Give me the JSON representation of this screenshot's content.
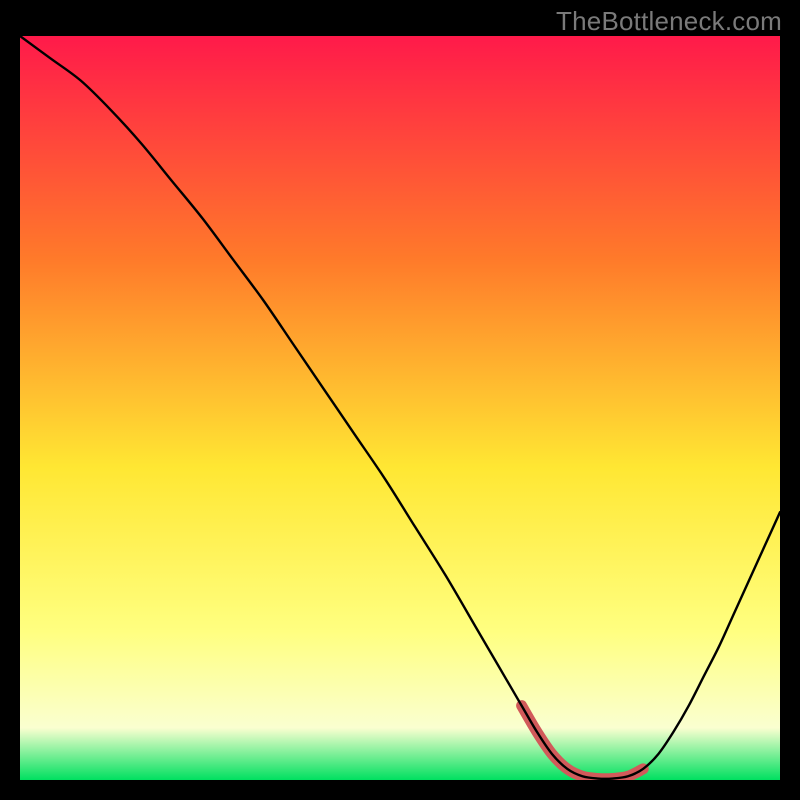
{
  "watermark": "TheBottleneck.com",
  "colors": {
    "outer_bg": "#000000",
    "line": "#000000",
    "highlight": "#d15a5a",
    "grad_top": "#ff1a4a",
    "grad_upper": "#ff7a2a",
    "grad_mid": "#ffe733",
    "grad_lowmid": "#ffff80",
    "grad_low": "#faffd0",
    "grad_bottom": "#00e060"
  },
  "chart_data": {
    "type": "line",
    "title": "",
    "xlabel": "",
    "ylabel": "",
    "xlim": [
      0,
      100
    ],
    "ylim": [
      0,
      100
    ],
    "x": [
      0,
      4,
      8,
      12,
      16,
      20,
      24,
      28,
      32,
      36,
      40,
      44,
      48,
      52,
      56,
      60,
      62,
      64,
      66,
      68,
      70,
      72,
      74,
      76,
      78,
      80,
      82,
      84,
      86,
      88,
      90,
      92,
      94,
      96,
      98,
      100
    ],
    "y": [
      100,
      97,
      94,
      90,
      85.5,
      80.5,
      75.5,
      70,
      64.5,
      58.5,
      52.5,
      46.5,
      40.5,
      34,
      27.5,
      20.5,
      17,
      13.5,
      10,
      6.5,
      3.5,
      1.5,
      0.5,
      0.2,
      0.2,
      0.5,
      1.5,
      3.5,
      6.5,
      10,
      14,
      18,
      22.5,
      27,
      31.5,
      36
    ],
    "highlight_range_x": [
      66,
      83
    ],
    "legend": null,
    "grid": false
  }
}
